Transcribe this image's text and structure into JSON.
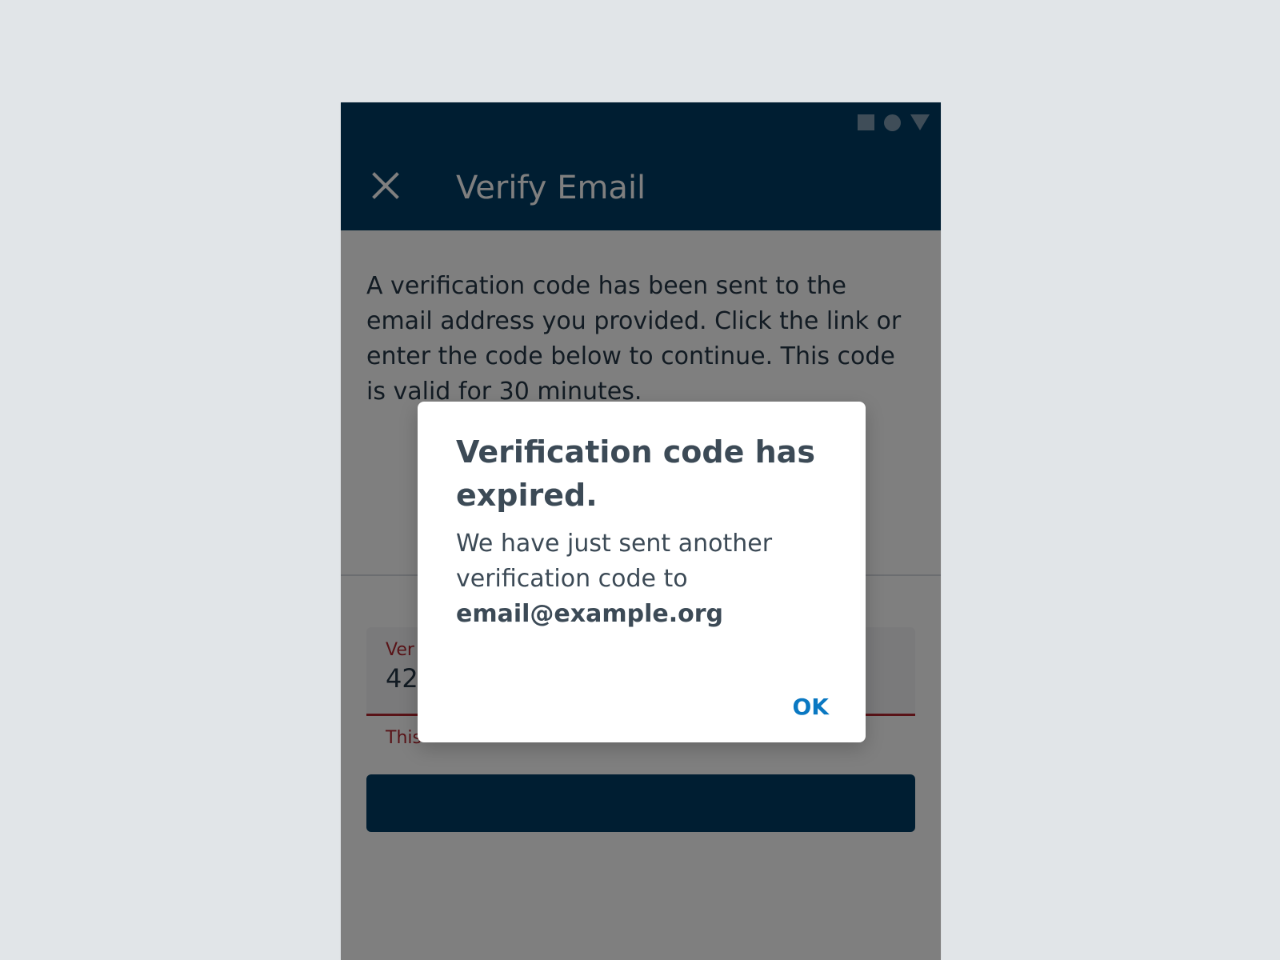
{
  "status_bar": {
    "icons": [
      "square-icon",
      "circle-icon",
      "triangle-icon"
    ]
  },
  "appbar": {
    "title": "Verify Email",
    "close_icon": "close-icon"
  },
  "content": {
    "intro": "A verification code has been sent to the email address you provided. Click the link or enter the code below to continue. This code is valid for 30 minutes.",
    "code_field": {
      "label_visible": "Ver",
      "value_visible": "42"
    },
    "error_visible": "This"
  },
  "dialog": {
    "title": "Verification code has expired.",
    "body_prefix": "We have just sent another verification code to",
    "email": "email@example.org",
    "ok_label": "OK"
  },
  "colors": {
    "page_background": "#e1e5e8",
    "appbar": "#003c64",
    "error": "#b3262f",
    "link": "#0a78c2",
    "text": "#253746"
  }
}
